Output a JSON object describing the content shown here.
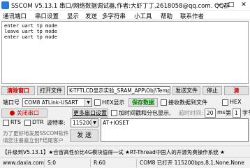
{
  "window": {
    "title": "SSCOM V5.13.1 串口/网络数据调试器,作者:大虾丁丁,2618058@qq.com. QQ群",
    "minimize": "—",
    "maximize": "□",
    "close": "✕"
  },
  "menu": [
    "通讯端口",
    "串口设置",
    "显示",
    "发送",
    "多字符串",
    "小工具",
    "帮助",
    "联系作者"
  ],
  "output_lines": [
    "enter uart tp mode",
    "leave uart tp mode",
    "enter uart tp mode"
  ],
  "row1": {
    "clear_window": "清除窗口",
    "open_file": "打开文件",
    "file_path": "K-TFTLCD显示实验_SRAM_APP\\Obj\\Template.bin",
    "send_file": "发送文件",
    "stop": "停止",
    "clear_send": "清"
  },
  "row2": {
    "port_label": "端口号",
    "port_value": "COM8 ATLink-USART",
    "hex_display": "HEX显示",
    "save_data": "保存数据",
    "recv_to_file": "接收数据到文件",
    "hex_send": "HEX"
  },
  "row3": {
    "close_port": "关闭串口",
    "more_settings": "更多串口设置",
    "timestamp": "加时间戳和分包显示,",
    "timeout_label": "超时时间:",
    "timeout_value": "20",
    "ms": "ms",
    "nth_label": "第",
    "nth_value": "1",
    "byte_label": "字节"
  },
  "row4": {
    "rts": "RTS",
    "dtr": "DTR",
    "baud_label": "波特率:",
    "baud_value": "115200",
    "send_text": "AT+IOSET"
  },
  "row5": {
    "notice_line1": "为了更好地发展SSCOM软件",
    "notice_line2": "请您注册嘉立创F结尾客户",
    "send_button": "发 送"
  },
  "ticker": "【升级到V5.13.1】★合宙高性价比4G模块值得一试 ★RT-Thread中国人的开源免费操作系统 ★",
  "status": {
    "website": "www.daxia.com",
    "s": "S:0",
    "r": "R:60",
    "port_status": "COM8 已打开  115200bps,8,1,None,None"
  }
}
